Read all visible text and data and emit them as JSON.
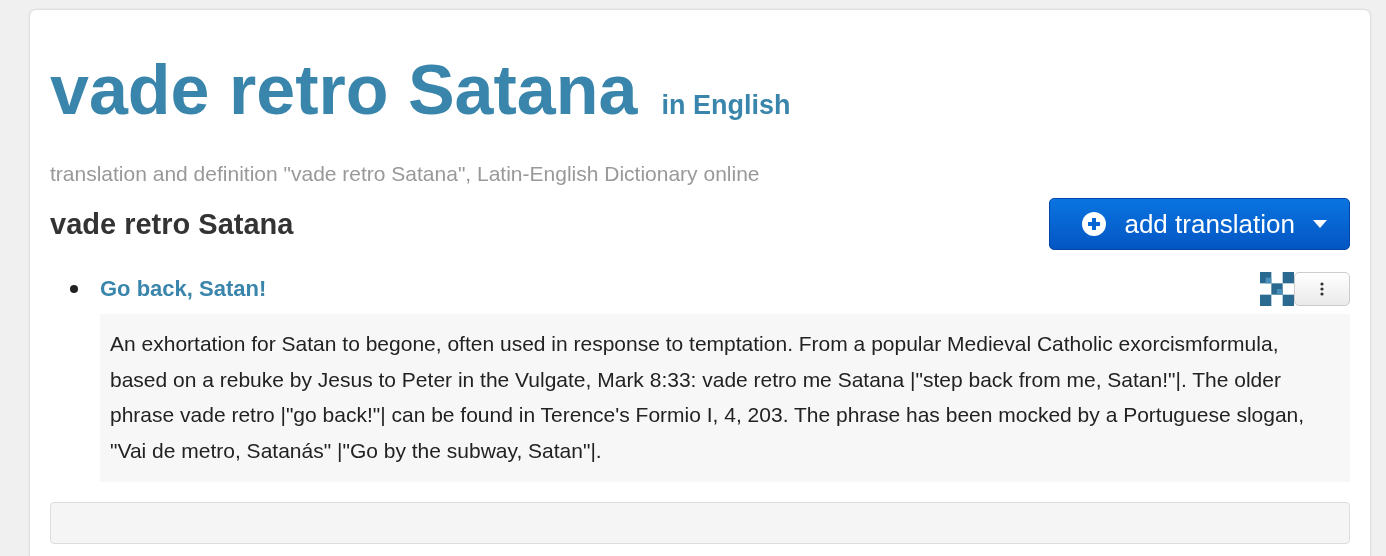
{
  "title": "vade retro Satana",
  "title_suffix": "in English",
  "subtitle": "translation and definition \"vade retro Satana\", Latin-English Dictionary  online",
  "phrase": "vade retro Satana",
  "add_button": {
    "label": "add translation"
  },
  "translations": [
    {
      "text": "Go back, Satan!",
      "definition": "An exhortation for Satan to begone, often used in response to temptation. From a popular Medieval Catholic exorcismformula, based on a rebuke by Jesus to Peter in the Vulgate, Mark 8:33: vade retro me Satana |\"step back from me, Satan!\"|. The older phrase vade retro |\"go back!\"| can be found in Terence's Formio I, 4, 203. The phrase has been mocked by a Portuguese slogan, \"Vai de metro, Satanás\" |\"Go by the subway, Satan\"|."
    }
  ]
}
